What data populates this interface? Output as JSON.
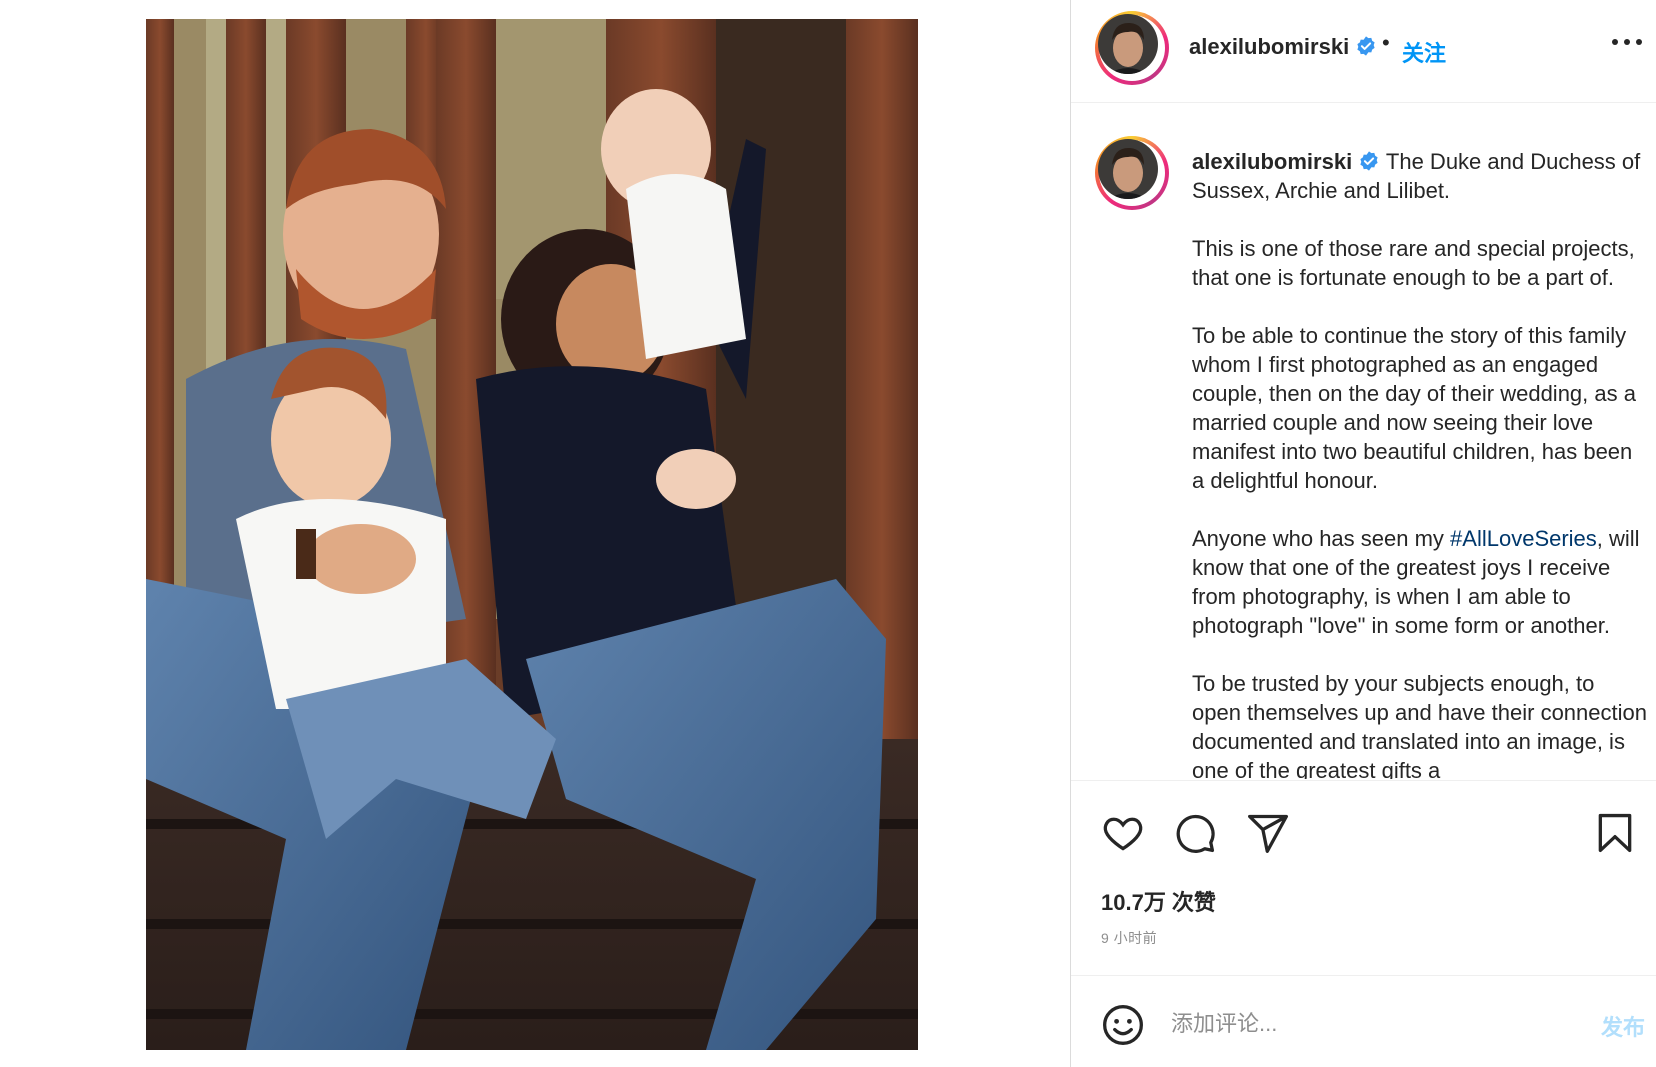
{
  "post": {
    "photo": {
      "icon": "family-photo"
    }
  },
  "header": {
    "username": "alexilubomirski",
    "dot": "•",
    "follow_label": "关注",
    "more_icon": "more-horizontal-icon"
  },
  "caption": {
    "username": "alexilubomirski",
    "intro": "The Duke and Duchess of Sussex, Archie and Lilibet.",
    "p1": "This is one of those rare and special projects, that one is fortunate enough to be a part of.",
    "p2": "To be able to continue the story of this family whom I first photographed as an engaged couple, then on the day of their wedding, as a married couple and now seeing their love manifest into two beautiful children, has been a delightful honour.",
    "p3_before": "Anyone who has seen my ",
    "p3_hashtag": "#AllLoveSeries",
    "p3_after": ", will know that one of the greatest joys I receive from photography, is when I am able to photograph \"love\" in some form or another.",
    "p4": "To be trusted by your subjects enough, to open themselves up and have their connection documented and translated into an image, is one of the greatest gifts a"
  },
  "actions": {
    "likes": "10.7万 次赞",
    "time": "9 小时前"
  },
  "comment": {
    "placeholder": "添加评论...",
    "post_label": "发布"
  },
  "colors": {
    "accent": "#0095f6",
    "hashtag": "#00376b",
    "post_disabled": "#b2dffc",
    "text": "#262626",
    "muted": "#8e8e8e"
  }
}
